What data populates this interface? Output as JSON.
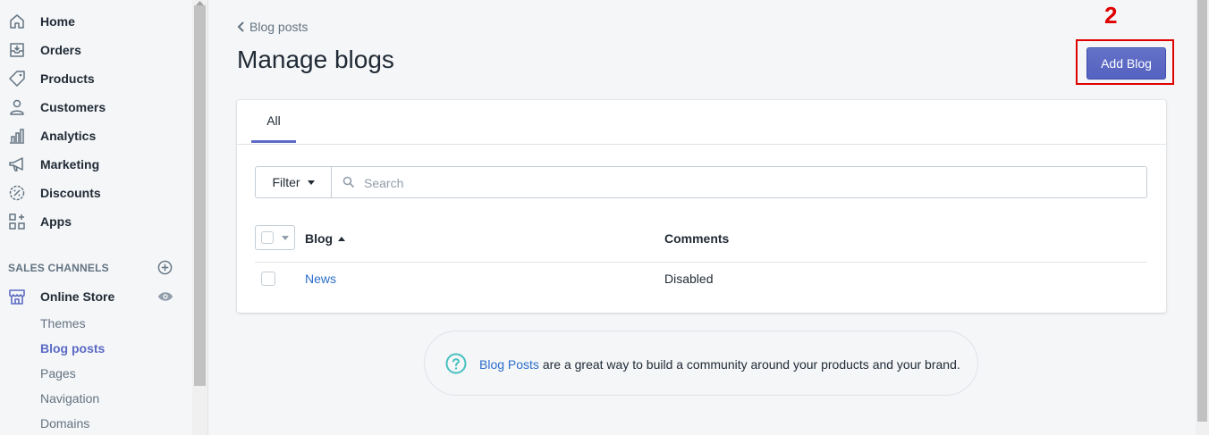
{
  "sidebar": {
    "items": [
      {
        "label": "Home",
        "icon": "home-icon"
      },
      {
        "label": "Orders",
        "icon": "orders-icon"
      },
      {
        "label": "Products",
        "icon": "tag-icon"
      },
      {
        "label": "Customers",
        "icon": "person-icon"
      },
      {
        "label": "Analytics",
        "icon": "bar-chart-icon"
      },
      {
        "label": "Marketing",
        "icon": "megaphone-icon"
      },
      {
        "label": "Discounts",
        "icon": "discount-icon"
      },
      {
        "label": "Apps",
        "icon": "apps-icon"
      }
    ],
    "sales_channels_title": "SALES CHANNELS",
    "online_store": "Online Store",
    "sub_items": [
      {
        "label": "Themes"
      },
      {
        "label": "Blog posts"
      },
      {
        "label": "Pages"
      },
      {
        "label": "Navigation"
      },
      {
        "label": "Domains"
      }
    ]
  },
  "header": {
    "back_label": "Blog posts",
    "title": "Manage blogs",
    "add_button": "Add Blog",
    "annotation": "2"
  },
  "tabs": [
    {
      "label": "All"
    }
  ],
  "filter": {
    "button_label": "Filter",
    "search_placeholder": "Search"
  },
  "table": {
    "columns": [
      "Blog",
      "Comments"
    ],
    "rows": [
      {
        "blog": "News",
        "comments": "Disabled"
      }
    ]
  },
  "help": {
    "link": "Blog Posts",
    "text": " are a great way to build a community around your products and your brand."
  },
  "colors": {
    "accent": "#5c6ac4",
    "link": "#2c6ecb",
    "annotation": "#e00000"
  }
}
